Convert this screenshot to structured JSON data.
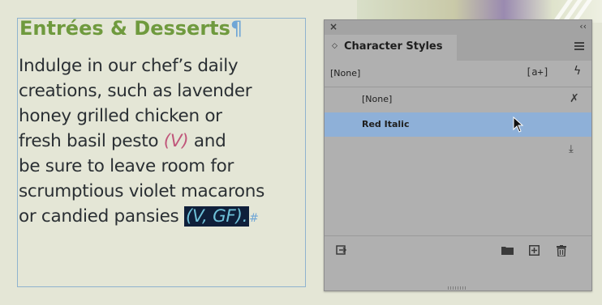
{
  "document": {
    "heading": "Entrées & Desserts",
    "heading_mark": "¶",
    "lines": [
      "Indulge in our chef’s daily",
      "creations, such as lavender",
      "honey grilled chicken or",
      "be sure to leave room for",
      "scrumptious violet macarons"
    ],
    "line4_prefix": "fresh basil pesto ",
    "line4_italic": "(V)",
    "line4_suffix": " and",
    "line7_prefix": "or candied pansies ",
    "line7_selected": "(V, GF).",
    "line7_end_mark": "#"
  },
  "panel": {
    "close_glyph": "×",
    "collapse_glyph": "‹‹",
    "tab_arrows": "◇",
    "tab_label": "Character Styles",
    "default_style": "[None]",
    "quick_apply_glyph": "[a+]",
    "bolt_glyph": "ϟ",
    "styles": [
      {
        "label": "[None]",
        "selected": false
      },
      {
        "label": "Red Italic",
        "selected": true
      }
    ],
    "clear_override_glyph": "✗",
    "load_glyph": "⤓",
    "bottom_icons": {
      "new_group": "▰",
      "new_style": "⊞",
      "delete": "🗑"
    },
    "colors": {
      "panel_bg": "#b0b0b0",
      "selected_row": "#8eb0d8"
    }
  }
}
